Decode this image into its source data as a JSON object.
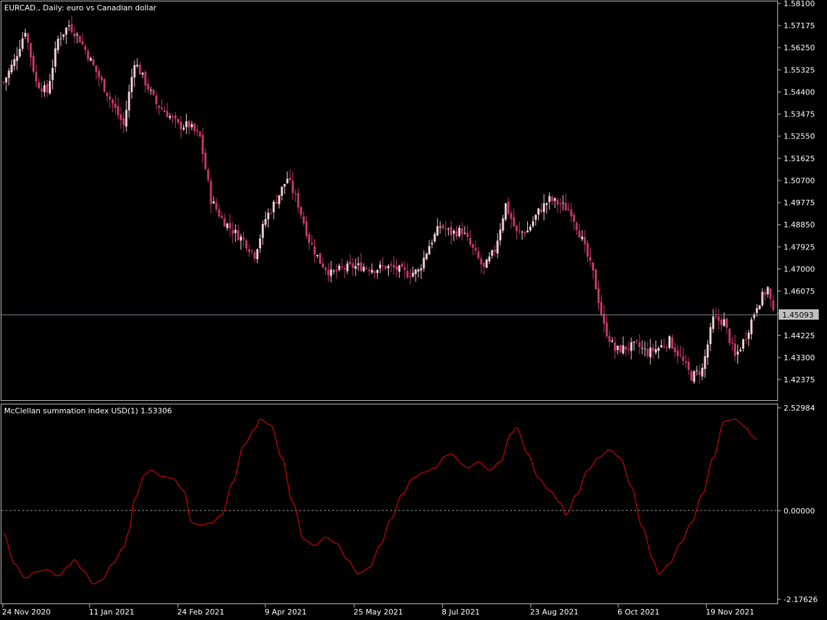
{
  "main_pane": {
    "label": "EURCAD., Daily:  euro vs Canadian dollar",
    "price_ticks": [
      "1.58100",
      "1.57175",
      "1.56250",
      "1.55325",
      "1.54400",
      "1.53475",
      "1.52550",
      "1.51625",
      "1.50700",
      "1.49775",
      "1.48850",
      "1.47925",
      "1.47000",
      "1.46075",
      "1.45150",
      "1.44225",
      "1.43300",
      "1.42375"
    ],
    "current_price": "1.45093"
  },
  "indicator_pane": {
    "label": "McClellan summation index USD(1) 1.53306",
    "ticks": [
      "2.52984",
      "0.00000",
      "-2.17626"
    ]
  },
  "x_axis": {
    "labels": [
      "24 Nov 2020",
      "11 Jan 2021",
      "24 Feb 2021",
      "9 Apr 2021",
      "25 May 2021",
      "8 Jul 2021",
      "23 Aug 2021",
      "6 Oct 2021",
      "19 Nov 2021"
    ]
  },
  "colors": {
    "background": "#000000",
    "bull": "#f5d0d8",
    "bear": "#c8376a",
    "indicator": "#ff0000",
    "grid": "#c0c0c0"
  },
  "chart_data": [
    {
      "type": "candlestick",
      "title": "EURCAD., Daily:  euro vs Canadian dollar",
      "ylim": [
        1.42,
        1.581
      ],
      "current_price": 1.45093,
      "start_date": "24 Nov 2020",
      "end_date": "20 Dec 2021",
      "close_path": [
        [
          0,
          1.548
        ],
        [
          4,
          1.557
        ],
        [
          8,
          1.57
        ],
        [
          12,
          1.548
        ],
        [
          16,
          1.544
        ],
        [
          20,
          1.566
        ],
        [
          24,
          1.572
        ],
        [
          28,
          1.566
        ],
        [
          32,
          1.557
        ],
        [
          36,
          1.548
        ],
        [
          40,
          1.539
        ],
        [
          44,
          1.53
        ],
        [
          48,
          1.557
        ],
        [
          52,
          1.548
        ],
        [
          56,
          1.539
        ],
        [
          60,
          1.535
        ],
        [
          64,
          1.53
        ],
        [
          68,
          1.53
        ],
        [
          72,
          1.525
        ],
        [
          76,
          1.499
        ],
        [
          80,
          1.491
        ],
        [
          84,
          1.486
        ],
        [
          88,
          1.482
        ],
        [
          92,
          1.476
        ],
        [
          96,
          1.491
        ],
        [
          100,
          1.499
        ],
        [
          104,
          1.508
        ],
        [
          108,
          1.497
        ],
        [
          112,
          1.482
        ],
        [
          116,
          1.473
        ],
        [
          120,
          1.468
        ],
        [
          124,
          1.47
        ],
        [
          128,
          1.471
        ],
        [
          132,
          1.471
        ],
        [
          136,
          1.47
        ],
        [
          140,
          1.471
        ],
        [
          144,
          1.47
        ],
        [
          148,
          1.468
        ],
        [
          152,
          1.469
        ],
        [
          156,
          1.48
        ],
        [
          160,
          1.488
        ],
        [
          164,
          1.485
        ],
        [
          168,
          1.486
        ],
        [
          172,
          1.478
        ],
        [
          176,
          1.47
        ],
        [
          180,
          1.478
        ],
        [
          184,
          1.497
        ],
        [
          188,
          1.485
        ],
        [
          192,
          1.486
        ],
        [
          196,
          1.494
        ],
        [
          200,
          1.499
        ],
        [
          204,
          1.497
        ],
        [
          208,
          1.494
        ],
        [
          212,
          1.482
        ],
        [
          216,
          1.468
        ],
        [
          220,
          1.446
        ],
        [
          224,
          1.436
        ],
        [
          228,
          1.437
        ],
        [
          232,
          1.438
        ],
        [
          236,
          1.435
        ],
        [
          240,
          1.437
        ],
        [
          244,
          1.44
        ],
        [
          248,
          1.433
        ],
        [
          252,
          1.425
        ],
        [
          256,
          1.428
        ],
        [
          260,
          1.449
        ],
        [
          264,
          1.448
        ],
        [
          268,
          1.433
        ],
        [
          272,
          1.442
        ],
        [
          276,
          1.455
        ],
        [
          280,
          1.462
        ],
        [
          282,
          1.451
        ]
      ]
    },
    {
      "type": "line",
      "title": "McClellan summation index USD(1) 1.53306",
      "ylim": [
        -2.17626,
        2.52984
      ],
      "last_value": 1.53306,
      "start_date": "24 Nov 2020",
      "end_date": "20 Dec 2021",
      "points": [
        [
          0,
          -0.55
        ],
        [
          4,
          -1.3
        ],
        [
          8,
          -1.65
        ],
        [
          12,
          -1.5
        ],
        [
          16,
          -1.45
        ],
        [
          20,
          -1.6
        ],
        [
          24,
          -1.35
        ],
        [
          26,
          -1.2
        ],
        [
          29,
          -1.45
        ],
        [
          33,
          -1.8
        ],
        [
          36,
          -1.7
        ],
        [
          40,
          -1.3
        ],
        [
          44,
          -0.9
        ],
        [
          46,
          -0.5
        ],
        [
          48,
          0.3
        ],
        [
          52,
          0.9
        ],
        [
          54,
          1.0
        ],
        [
          58,
          0.85
        ],
        [
          62,
          0.8
        ],
        [
          66,
          0.5
        ],
        [
          69,
          -0.3
        ],
        [
          72,
          -0.35
        ],
        [
          76,
          -0.3
        ],
        [
          80,
          -0.1
        ],
        [
          84,
          0.7
        ],
        [
          88,
          1.6
        ],
        [
          92,
          2.0
        ],
        [
          94,
          2.25
        ],
        [
          98,
          2.1
        ],
        [
          102,
          1.3
        ],
        [
          106,
          0.2
        ],
        [
          110,
          -0.7
        ],
        [
          114,
          -0.85
        ],
        [
          118,
          -0.65
        ],
        [
          122,
          -0.8
        ],
        [
          126,
          -1.2
        ],
        [
          130,
          -1.55
        ],
        [
          134,
          -1.4
        ],
        [
          138,
          -0.85
        ],
        [
          142,
          -0.2
        ],
        [
          146,
          0.4
        ],
        [
          150,
          0.8
        ],
        [
          154,
          0.95
        ],
        [
          158,
          1.05
        ],
        [
          162,
          1.35
        ],
        [
          164,
          1.4
        ],
        [
          168,
          1.15
        ],
        [
          170,
          1.05
        ],
        [
          174,
          1.2
        ],
        [
          178,
          1.0
        ],
        [
          182,
          1.2
        ],
        [
          186,
          1.9
        ],
        [
          188,
          2.05
        ],
        [
          192,
          1.4
        ],
        [
          196,
          0.8
        ],
        [
          200,
          0.5
        ],
        [
          204,
          0.2
        ],
        [
          206,
          -0.1
        ],
        [
          210,
          0.4
        ],
        [
          214,
          1.0
        ],
        [
          218,
          1.3
        ],
        [
          222,
          1.5
        ],
        [
          226,
          1.3
        ],
        [
          230,
          0.6
        ],
        [
          234,
          -0.4
        ],
        [
          238,
          -1.2
        ],
        [
          240,
          -1.55
        ],
        [
          244,
          -1.3
        ],
        [
          248,
          -0.8
        ],
        [
          252,
          -0.3
        ],
        [
          256,
          0.4
        ],
        [
          260,
          1.3
        ],
        [
          264,
          2.2
        ],
        [
          268,
          2.25
        ],
        [
          272,
          2.05
        ],
        [
          274,
          1.85
        ],
        [
          276,
          1.75
        ]
      ]
    }
  ]
}
